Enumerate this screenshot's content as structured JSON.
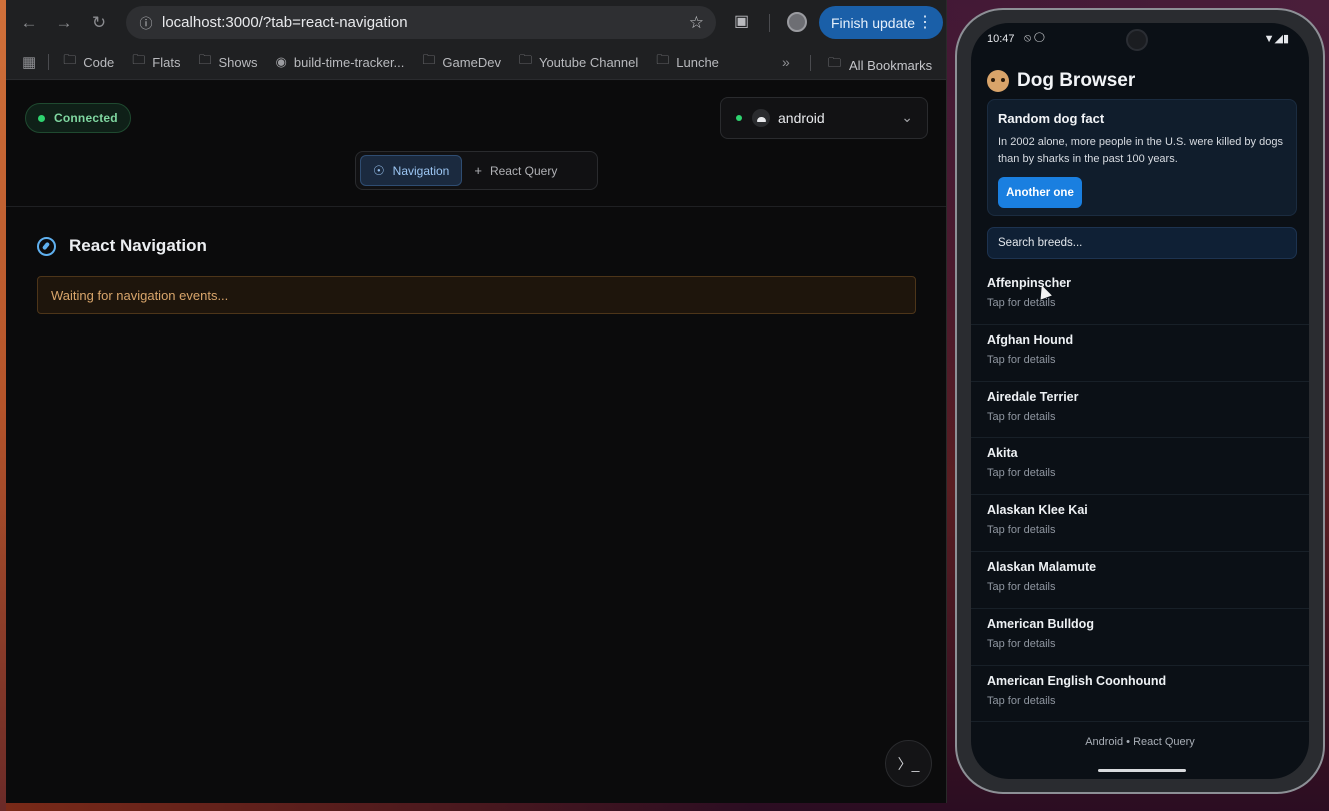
{
  "browser": {
    "url": "localhost:3000/?tab=react-navigation",
    "finish_update": "Finish update",
    "bookmarks": [
      "Code",
      "Flats",
      "Shows",
      "build-time-tracker...",
      "GameDev",
      "Youtube Channel",
      "Lunche"
    ],
    "all_bookmarks": "All Bookmarks"
  },
  "app": {
    "connection_status": "Connected",
    "device_name": "android",
    "tabs": [
      {
        "label": "Navigation",
        "active": true
      },
      {
        "label": "React Query",
        "active": false
      }
    ],
    "section_title": "React Navigation",
    "waiting_message": "Waiting for navigation events..."
  },
  "phone": {
    "time": "10:47",
    "title": "Dog Browser",
    "fact_card": {
      "title": "Random dog fact",
      "text": "In 2002 alone, more people in the U.S. were killed by dogs than by sharks in the past 100 years.",
      "button": "Another one"
    },
    "search_placeholder": "Search breeds...",
    "breeds": [
      {
        "name": "Affenpinscher",
        "sub": "Tap for details"
      },
      {
        "name": "Afghan Hound",
        "sub": "Tap for details"
      },
      {
        "name": "Airedale Terrier",
        "sub": "Tap for details"
      },
      {
        "name": "Akita",
        "sub": "Tap for details"
      },
      {
        "name": "Alaskan Klee Kai",
        "sub": "Tap for details"
      },
      {
        "name": "Alaskan Malamute",
        "sub": "Tap for details"
      },
      {
        "name": "American Bulldog",
        "sub": "Tap for details"
      },
      {
        "name": "American English Coonhound",
        "sub": "Tap for details"
      }
    ],
    "footer": "Android • React Query"
  },
  "colors": {
    "accent_blue": "#1a7fe0",
    "connected_green": "#2ed36f",
    "waiting_amber": "#d8a56b"
  }
}
